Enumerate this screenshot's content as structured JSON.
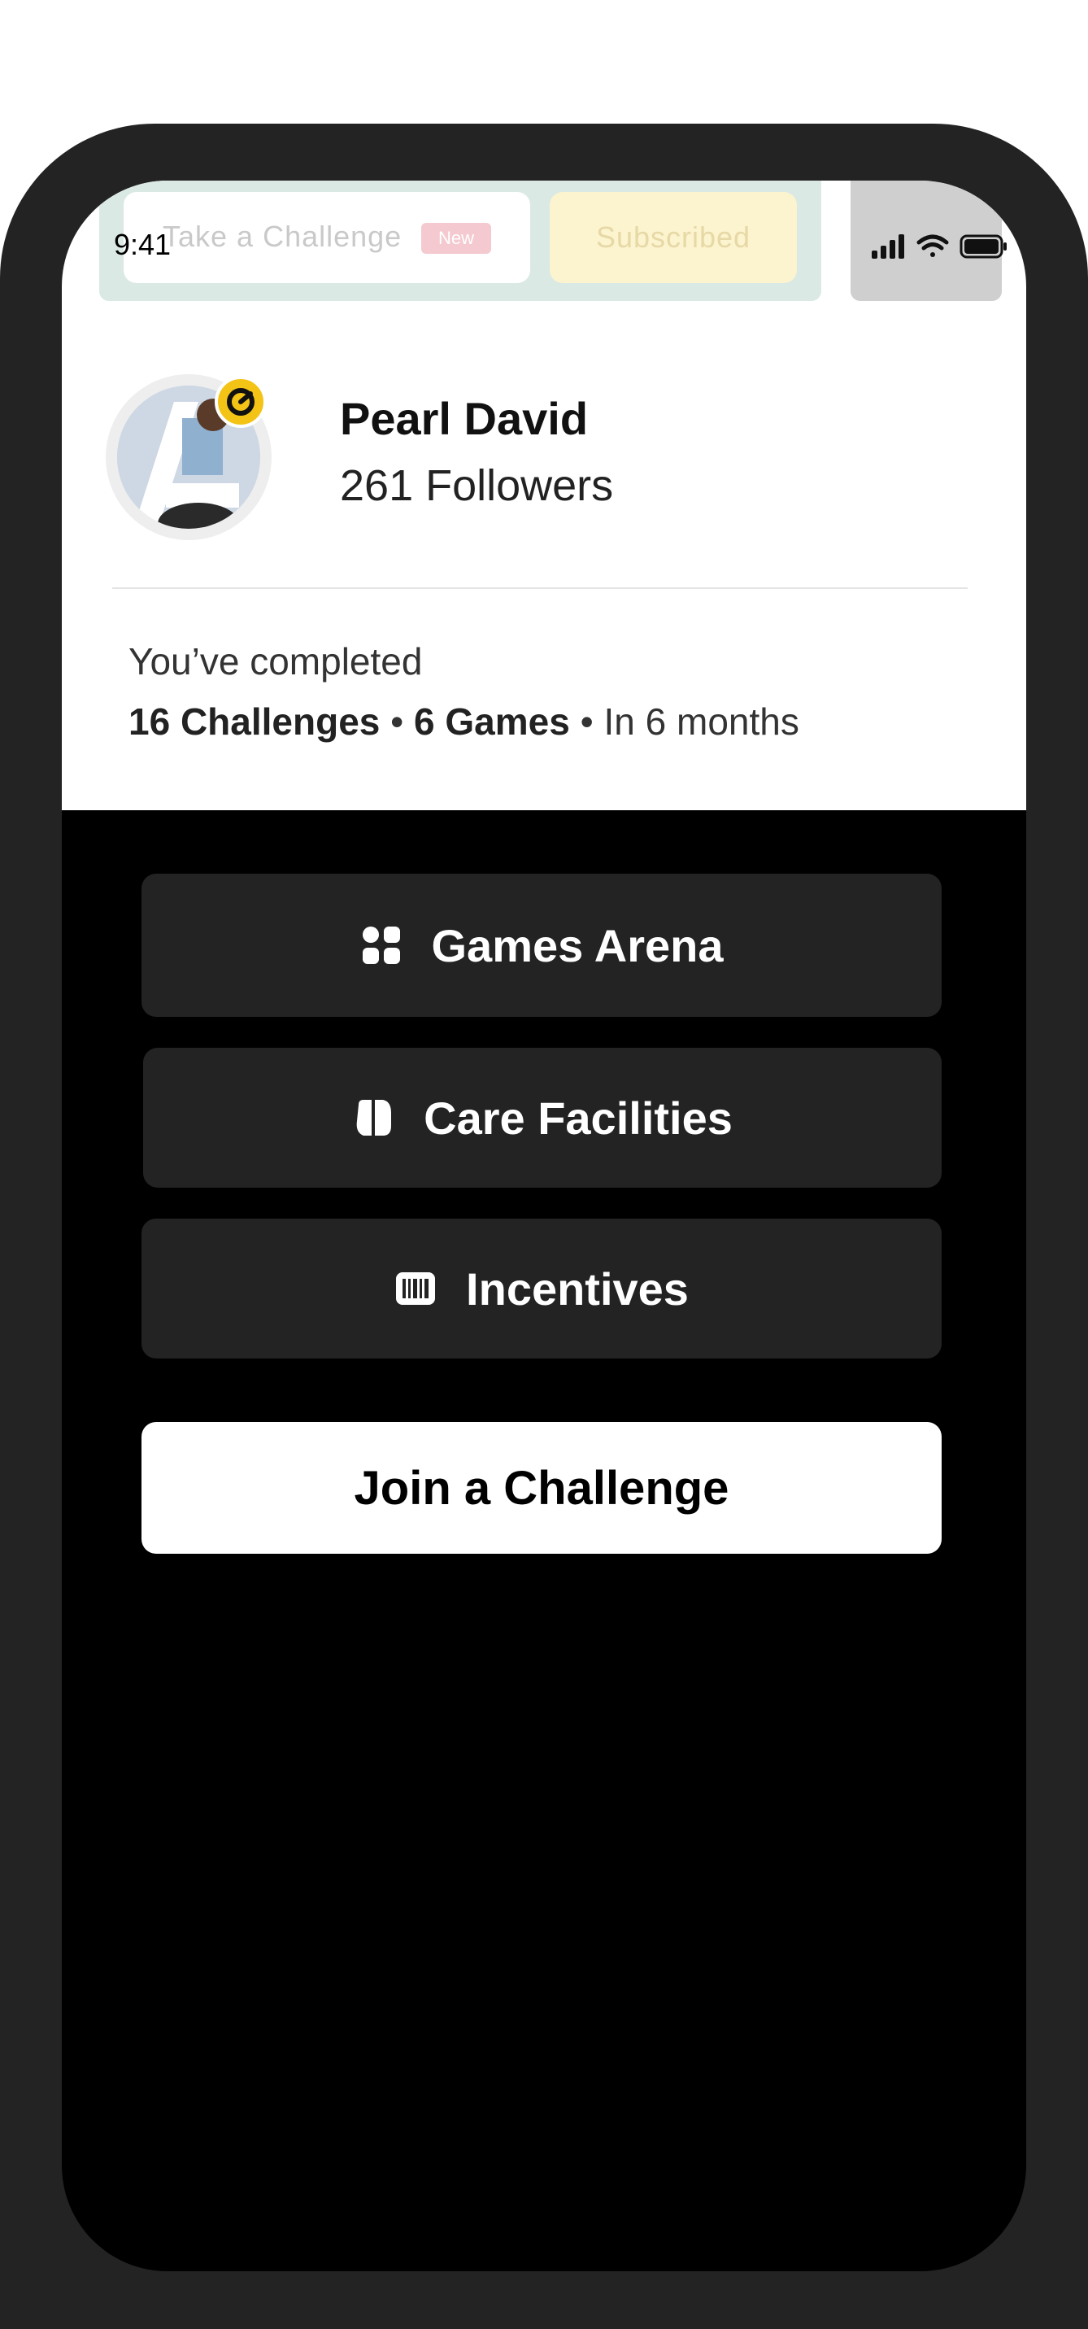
{
  "status_bar": {
    "time": "9:41"
  },
  "top_strip": {
    "challenge_label": "Take a Challenge",
    "new_badge": "New",
    "subscribed_label": "Subscribed"
  },
  "profile": {
    "name": "Pearl David",
    "followers": "261 Followers"
  },
  "completion": {
    "intro": "You’ve completed",
    "challenges": "16 Challenges",
    "games": "6 Games",
    "period": "In 6 months"
  },
  "menu": {
    "items": [
      {
        "label": "Games Arena",
        "icon": "grid-icon"
      },
      {
        "label": "Care Facilities",
        "icon": "care-facility-icon"
      },
      {
        "label": "Incentives",
        "icon": "barcode-icon"
      }
    ],
    "join_label": "Join a Challenge"
  },
  "colors": {
    "background": "#000000",
    "card": "#ffffff",
    "menu_button": "#232323",
    "badge": "#f3c316"
  }
}
